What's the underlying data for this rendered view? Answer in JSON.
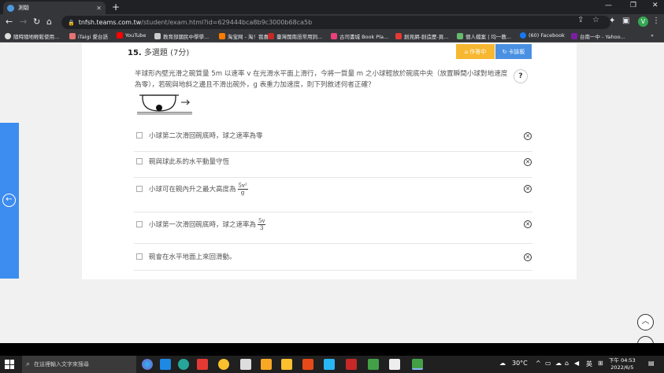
{
  "browser": {
    "tab_title": "測驗",
    "url_host": "tnfsh.teams.com.tw",
    "url_path": "/student/exam.html?id=629444bca8b9c3000b68ca5b",
    "bookmarks": [
      "隨時隨地輕鬆使用...",
      "iTaigi 愛台語",
      "YouTube",
      "教育部國民中學學...",
      "淘宝网 - 淘！我喜欢",
      "臺灣閩南語常用詞...",
      "古司書城 Book Pla...",
      "創見網-創造歷-頁...",
      "個人檔案 | 均一教...",
      "(60) Facebook",
      "台南一中 - Yahoo..."
    ],
    "profile_initial": "V"
  },
  "question": {
    "number": "15.",
    "type": "多選題 (7分)",
    "button_left": "作答中",
    "button_right": "卡誌板",
    "help_label": "?",
    "stem": "半球形內壁光滑之碗質量 5m 以速率 v 在光滑水平面上滑行，今將一質量 m 之小球輕放於碗底中央（放置瞬間小球對地速度為零），若碗與地斜之邊且不滑出碗外，g 表重力加速度，則下列敘述何者正確？",
    "options": [
      {
        "text": "小球第二次滑回碗底時，球之速率為零",
        "frac_num": "",
        "frac_den": ""
      },
      {
        "text": "碗與球此系的水平動量守恆",
        "frac_num": "",
        "frac_den": ""
      },
      {
        "text": "小球可在碗內升之最大高度為",
        "frac_num": "5v²",
        "frac_den": "g"
      },
      {
        "text": "小球第一次滑回碗底時，球之速率為",
        "frac_num": "5v",
        "frac_den": "3"
      },
      {
        "text": "碗會在水平地面上來回滑動。",
        "frac_num": "",
        "frac_den": ""
      }
    ]
  },
  "taskbar": {
    "search_placeholder": "在這裡輸入文字來搜尋",
    "weather": "30°C",
    "ime": "英",
    "time": "下午 04:53",
    "date": "2022/6/5"
  },
  "colors": {
    "accent_blue": "#3d8cf0",
    "orange": "#f7b731",
    "blue_button": "#4a90e2"
  }
}
